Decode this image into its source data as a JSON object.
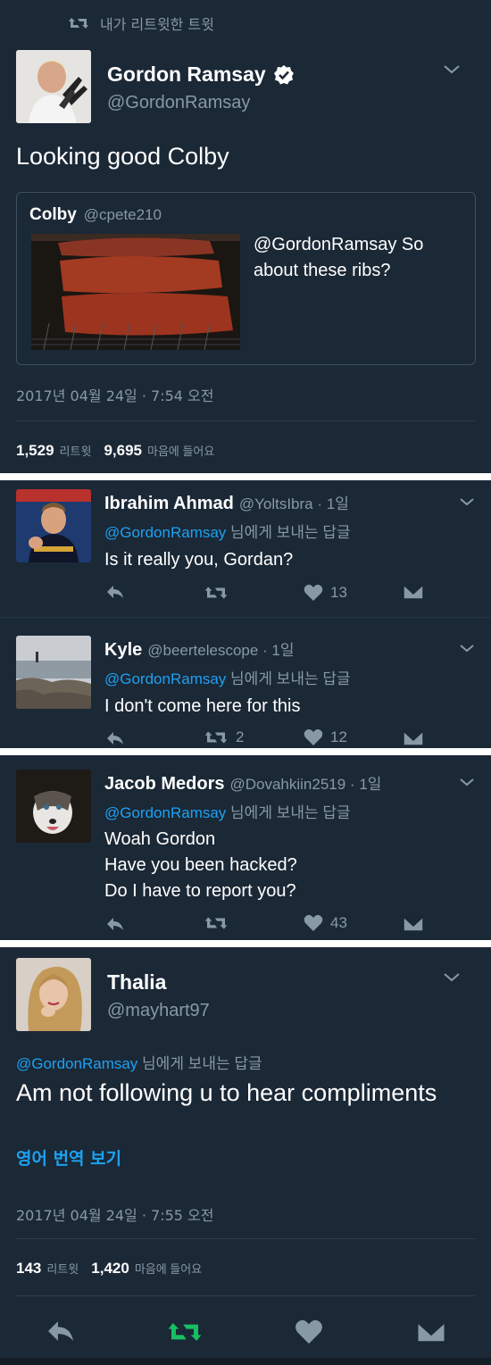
{
  "main_tweet": {
    "retweet_label": "내가 리트윗한 트윗",
    "name": "Gordon Ramsay",
    "handle": "@GordonRamsay",
    "text": "Looking good Colby",
    "quote": {
      "name": "Colby",
      "handle": "@cpete210",
      "text": "@GordonRamsay So about these ribs?"
    },
    "timestamp": "2017년 04월 24일 · 7:54 오전",
    "retweets": "1,529",
    "retweets_label": "리트윗",
    "likes": "9,695",
    "likes_label": "마음에 들어요"
  },
  "replies": [
    {
      "name": "Ibrahim Ahmad",
      "handle": "@YoltsIbra · 1일",
      "reply_to": "@GordonRamsay",
      "reply_suffix": " 님에게 보내는 답글",
      "lines": [
        "Is it really you, Gordan?"
      ],
      "retweets": "",
      "likes": "13"
    },
    {
      "name": "Kyle",
      "handle": "@beertelescope · 1일",
      "reply_to": "@GordonRamsay",
      "reply_suffix": " 님에게 보내는 답글",
      "lines": [
        "I don't come here for this"
      ],
      "retweets": "2",
      "likes": "12"
    },
    {
      "name": "Jacob Medors",
      "handle": "@Dovahkiin2519 · 1일",
      "reply_to": "@GordonRamsay",
      "reply_suffix": " 님에게 보내는 답글",
      "lines": [
        "Woah Gordon",
        "Have you been hacked?",
        "Do I have to report you?"
      ],
      "retweets": "",
      "likes": "43"
    }
  ],
  "last_tweet": {
    "name": "Thalia",
    "handle": "@mayhart97",
    "reply_to": "@GordonRamsay",
    "reply_suffix": " 님에게 보내는 답글",
    "text": "Am not following u to hear compliments",
    "translate": "영어 번역 보기",
    "timestamp": "2017년 04월 24일 · 7:55 오전",
    "retweets": "143",
    "retweets_label": "리트윗",
    "likes": "1,420",
    "likes_label": "마음에 들어요"
  },
  "colors": {
    "background": "#1b2836",
    "link": "#1da1f2",
    "muted": "#8899a6",
    "retweet_active": "#17bf63"
  },
  "icons": [
    "retweet-icon",
    "verified-icon",
    "chevron-down-icon",
    "reply-icon",
    "heart-icon",
    "dm-icon"
  ]
}
